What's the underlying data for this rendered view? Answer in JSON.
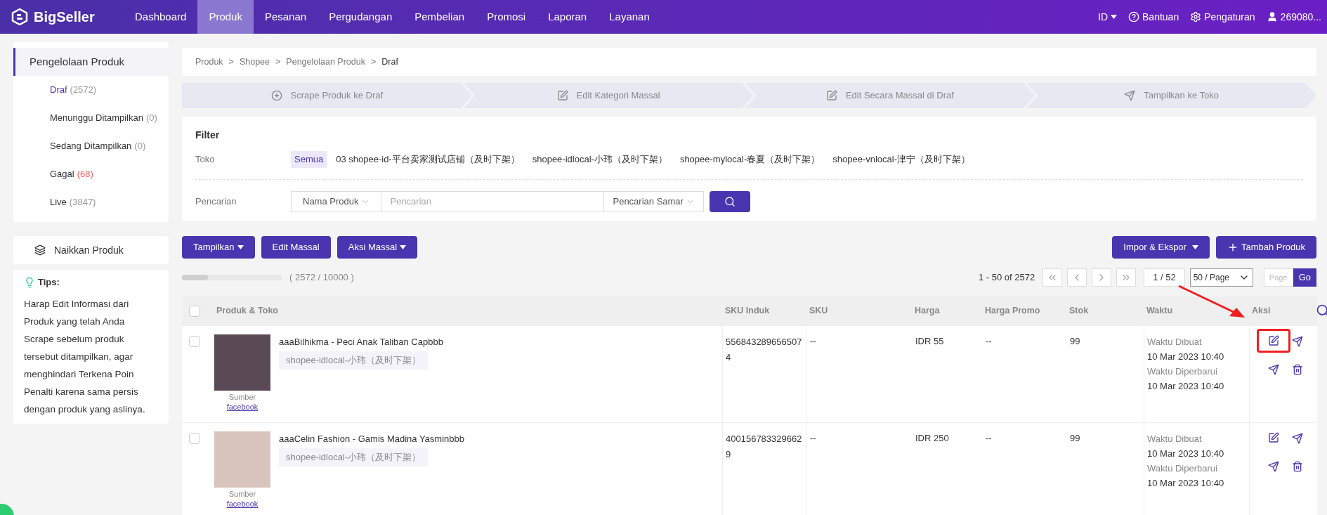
{
  "header": {
    "brand": "BigSeller",
    "nav": [
      {
        "label": "Dashboard",
        "selected": false
      },
      {
        "label": "Produk",
        "selected": true
      },
      {
        "label": "Pesanan",
        "selected": false
      },
      {
        "label": "Pergudangan",
        "selected": false
      },
      {
        "label": "Pembelian",
        "selected": false
      },
      {
        "label": "Promosi",
        "selected": false
      },
      {
        "label": "Laporan",
        "selected": false
      },
      {
        "label": "Layanan",
        "selected": false
      }
    ],
    "language": "ID",
    "help": "Bantuan",
    "settings": "Pengaturan",
    "user": "269080..."
  },
  "sidebar": {
    "title": "Pengelolaan Produk",
    "items": [
      {
        "label": "Draf",
        "count": "(2572)",
        "selected": true,
        "error": false
      },
      {
        "label": "Menunggu Ditampilkan",
        "count": "(0)",
        "selected": false,
        "error": false
      },
      {
        "label": "Sedang Ditampilkan",
        "count": "(0)",
        "selected": false,
        "error": false
      },
      {
        "label": "Gagal",
        "count": "(68)",
        "selected": false,
        "error": true
      },
      {
        "label": "Live",
        "count": "(3847)",
        "selected": false,
        "error": false
      }
    ],
    "upload": "Naikkan Produk",
    "tips": {
      "title": "Tips:",
      "text": "Harap Edit Informasi dari Produk yang telah Anda Scrape sebelum produk tersebut ditampilkan, agar menghindari Terkena Poin Penalti karena sama persis dengan produk yang aslinya."
    }
  },
  "breadcrumb": [
    {
      "label": "Produk"
    },
    {
      "separator": ">",
      "label": "Shopee"
    },
    {
      "separator": ">",
      "label": "Pengelolaan Produk"
    },
    {
      "separator": ">",
      "label": "Draf"
    }
  ],
  "steps": [
    {
      "kind": "add",
      "label": "Scrape Produk ke Draf"
    },
    {
      "kind": "edit",
      "label": "Edit Kategori Massal"
    },
    {
      "kind": "edit",
      "label": "Edit Secara Massal di Draf"
    },
    {
      "kind": "send",
      "label": "Tampilkan ke Toko"
    }
  ],
  "filter": {
    "title": "Filter",
    "store_label": "Toko",
    "stores": [
      {
        "label": "Semua",
        "selected": true
      },
      {
        "label": "03 shopee-id-平台卖家测试店铺（及时下架）",
        "selected": false
      },
      {
        "label": "shopee-idlocal-小玮（及时下架）",
        "selected": false
      },
      {
        "label": "shopee-mylocal-春夏（及时下架）",
        "selected": false
      },
      {
        "label": "shopee-vnlocal-津宁（及时下架）",
        "selected": false
      }
    ],
    "search_label": "Pencarian",
    "search_by": "Nama Produk",
    "placeholder": "Pencarian",
    "mode": "Pencarian Samar"
  },
  "toolbar": {
    "left": [
      {
        "label": "Tampilkan",
        "dropdown": true
      },
      {
        "label": "Edit Massal",
        "dropdown": false
      },
      {
        "label": "Aksi Massal",
        "dropdown": true
      }
    ],
    "right": [
      {
        "label": "Impor & Ekspor",
        "kind": "dropdown"
      },
      {
        "label": "Tambah Produk",
        "kind": "add"
      }
    ]
  },
  "quota": {
    "level": 0.2572,
    "label": "( 2572 / 10000 )"
  },
  "pagination": {
    "range": "1 - 50 of 2572",
    "page": "1 / 52",
    "per_page": "50 / Page",
    "page_placeholder": "Page",
    "go": "Go"
  },
  "table": {
    "select_all_checked": false,
    "columns": [
      "Produk & Toko",
      "SKU Induk",
      "SKU",
      "Harga",
      "Harga Promo",
      "Stok",
      "Waktu",
      "Aksi"
    ],
    "rows": [
      {
        "checked": false,
        "name": "aaaBilhikma - Peci Anak Taliban Capbbb",
        "store": "shopee-idlocal-小玮（及时下架）",
        "source_label": "Sumber",
        "source": "facebook",
        "sku_parent": "5568432896565074",
        "sku": "--",
        "price": "IDR 55",
        "promo": "--",
        "stock": "99",
        "created_label": "Waktu Dibuat",
        "created": "10 Mar 2023 10:40",
        "updated_label": "Waktu Diperbarui",
        "updated": "10 Mar 2023 10:40",
        "edit_highlighted": true
      },
      {
        "checked": false,
        "name": "aaaCelin Fashion - Gamis Madina Yasminbbb",
        "store": "shopee-idlocal-小玮（及时下架）",
        "source_label": "Sumber",
        "source": "facebook",
        "sku_parent": "4001567833296629",
        "sku": "--",
        "price": "IDR 250",
        "promo": "--",
        "stock": "99",
        "created_label": "Waktu Dibuat",
        "created": "10 Mar 2023 10:40",
        "updated_label": "Waktu Diperbarui",
        "updated": "10 Mar 2023 10:40",
        "edit_highlighted": false
      }
    ]
  }
}
